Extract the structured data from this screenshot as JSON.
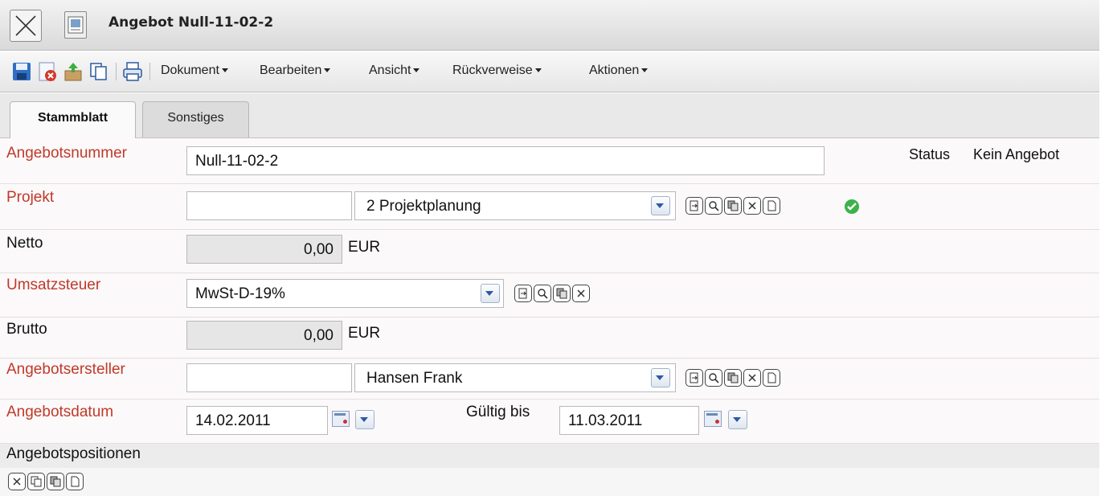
{
  "window": {
    "title": "Angebot Null-11-02-2"
  },
  "toolbar": {
    "menus": [
      "Dokument",
      "Bearbeiten",
      "Ansicht",
      "Rückverweise",
      "Aktionen"
    ]
  },
  "tabs": [
    {
      "label": "Stammblatt",
      "active": true
    },
    {
      "label": "Sonstiges",
      "active": false
    }
  ],
  "form": {
    "angebotsnummer": {
      "label": "Angebotsnummer",
      "value": "Null-11-02-2"
    },
    "status": {
      "label": "Status",
      "value": "Kein Angebot"
    },
    "projekt": {
      "label": "Projekt",
      "code": "",
      "value": "2 Projektplanung"
    },
    "netto": {
      "label": "Netto",
      "value": "0,00",
      "unit": "EUR"
    },
    "umsatzsteuer": {
      "label": "Umsatzsteuer",
      "value": "MwSt-D-19%"
    },
    "brutto": {
      "label": "Brutto",
      "value": "0,00",
      "unit": "EUR"
    },
    "angebotsersteller": {
      "label": "Angebotsersteller",
      "code": "",
      "value": "Hansen Frank"
    },
    "angebotsdatum": {
      "label": "Angebotsdatum",
      "value": "14.02.2011"
    },
    "gueltig_bis": {
      "label": "Gültig bis",
      "value": "11.03.2011"
    }
  },
  "positions": {
    "label": "Angebotspositionen"
  },
  "colors": {
    "required_label": "#c0392b",
    "ok_green": "#3cb34a",
    "accent_blue": "#2a5aa8"
  }
}
